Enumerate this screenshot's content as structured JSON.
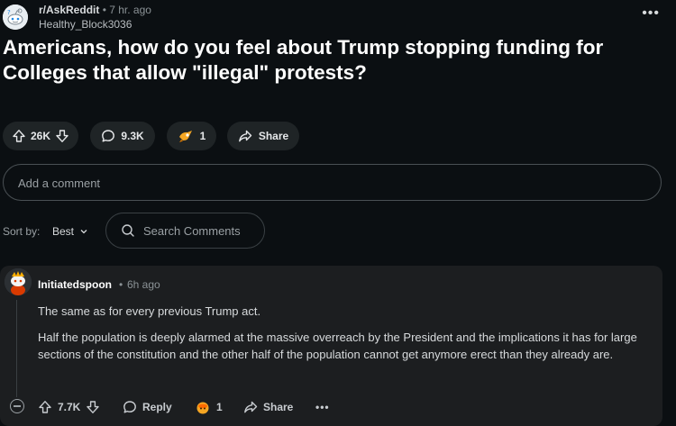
{
  "post": {
    "subreddit": "r/AskReddit",
    "separator": "•",
    "time_ago": "7 hr. ago",
    "author": "Healthy_Block3036",
    "title": "Americans, how do you feel about Trump stopping funding for Colleges that allow \"illegal\" protests?",
    "more_label": "•••"
  },
  "actions": {
    "votes": "26K",
    "comments": "9.3K",
    "awards": "1",
    "share": "Share"
  },
  "comment_box": {
    "placeholder": "Add a comment"
  },
  "sort": {
    "label": "Sort by:",
    "value": "Best"
  },
  "search": {
    "placeholder": "Search Comments"
  },
  "comment": {
    "author": "Initiatedspoon",
    "separator": "•",
    "time_ago": "6h ago",
    "paragraphs": [
      "The same as for every previous Trump act.",
      "Half the population is deeply alarmed at the massive overreach by the President and the implications it has for large sections of the constitution and the other half of the population cannot get anymore erect than they already are."
    ],
    "votes": "7.7K",
    "reply": "Reply",
    "awards": "1",
    "share": "Share",
    "more": "•••"
  },
  "colors": {
    "background": "#0b0f12",
    "pill": "#1f2426",
    "comment_card": "#1c1e20",
    "text": "#d7dadc",
    "muted": "#8b9296"
  },
  "icons": [
    "subreddit-snoo-icon",
    "upvote-icon",
    "downvote-icon",
    "comment-icon",
    "award-icon",
    "share-icon",
    "search-icon",
    "chevron-down-icon",
    "collapse-icon",
    "more-icon"
  ]
}
